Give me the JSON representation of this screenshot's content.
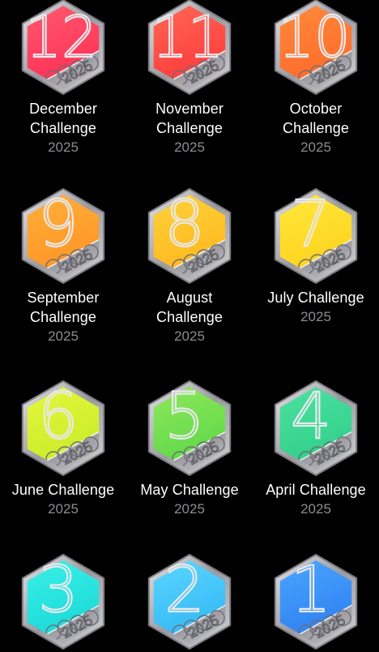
{
  "awards": [
    {
      "title_line1": "December",
      "title_line2": "Challenge",
      "year": "2025",
      "number": "12",
      "color_top": "#ff5a6e",
      "color_bottom": "#ff2f55"
    },
    {
      "title_line1": "November",
      "title_line2": "Challenge",
      "year": "2025",
      "number": "11",
      "color_top": "#ff6655",
      "color_bottom": "#ff3b3b"
    },
    {
      "title_line1": "October",
      "title_line2": "Challenge",
      "year": "2025",
      "number": "10",
      "color_top": "#ff8a3a",
      "color_bottom": "#ff6a2a"
    },
    {
      "title_line1": "September",
      "title_line2": "Challenge",
      "year": "2025",
      "number": "9",
      "color_top": "#ffb03a",
      "color_bottom": "#ff9425"
    },
    {
      "title_line1": "August",
      "title_line2": "Challenge",
      "year": "2025",
      "number": "8",
      "color_top": "#ffd13a",
      "color_bottom": "#ffb81e"
    },
    {
      "title_line1": "July Challenge",
      "title_line2": "",
      "year": "2025",
      "number": "7",
      "color_top": "#ffe83a",
      "color_bottom": "#ffd21e"
    },
    {
      "title_line1": "June Challenge",
      "title_line2": "",
      "year": "2025",
      "number": "6",
      "color_top": "#e6f63a",
      "color_bottom": "#c8ec2a"
    },
    {
      "title_line1": "May Challenge",
      "title_line2": "",
      "year": "2025",
      "number": "5",
      "color_top": "#8ee85a",
      "color_bottom": "#5fd84a"
    },
    {
      "title_line1": "April Challenge",
      "title_line2": "",
      "year": "2025",
      "number": "4",
      "color_top": "#4ee0a0",
      "color_bottom": "#2fd08a"
    },
    {
      "title_line1": "",
      "title_line2": "",
      "year": "",
      "number": "3",
      "color_top": "#3af0e6",
      "color_bottom": "#1ad8d8"
    },
    {
      "title_line1": "",
      "title_line2": "",
      "year": "",
      "number": "2",
      "color_top": "#5ad6ff",
      "color_bottom": "#34b8f4"
    },
    {
      "title_line1": "",
      "title_line2": "",
      "year": "",
      "number": "1",
      "color_top": "#4aa6ff",
      "color_bottom": "#2f80f0"
    }
  ],
  "badge_engraving": "2025",
  "colors": {
    "background": "#000000",
    "title": "#ffffff",
    "year": "#8c8c92",
    "metal": "#b8b8bc"
  }
}
